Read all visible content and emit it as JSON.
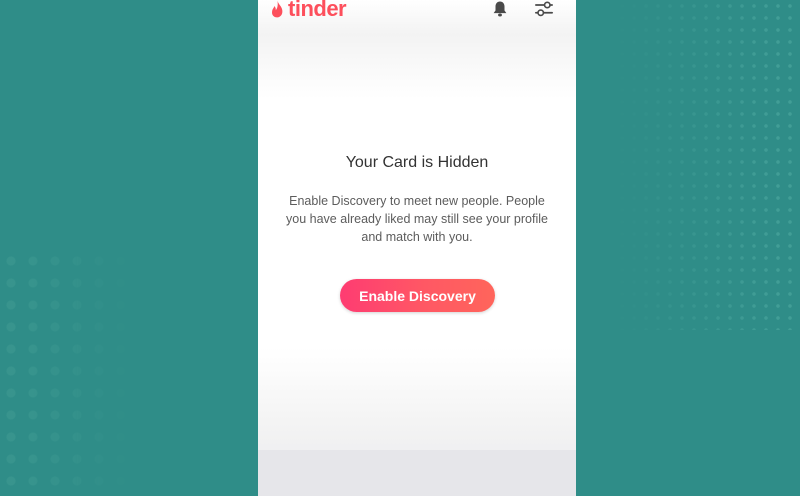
{
  "header": {
    "brand": "tinder",
    "icons": {
      "brand": "flame-icon",
      "notifications": "bell-icon",
      "filters": "sliders-icon"
    }
  },
  "card": {
    "title": "Your Card is Hidden",
    "description": "Enable Discovery to meet new people. People you have already liked may still see your profile and match with you.",
    "button_label": "Enable Discovery"
  },
  "colors": {
    "background": "#2f8d88",
    "brand": "#fd4f5c",
    "button_start": "#fe3c72",
    "button_end": "#ff655b"
  }
}
